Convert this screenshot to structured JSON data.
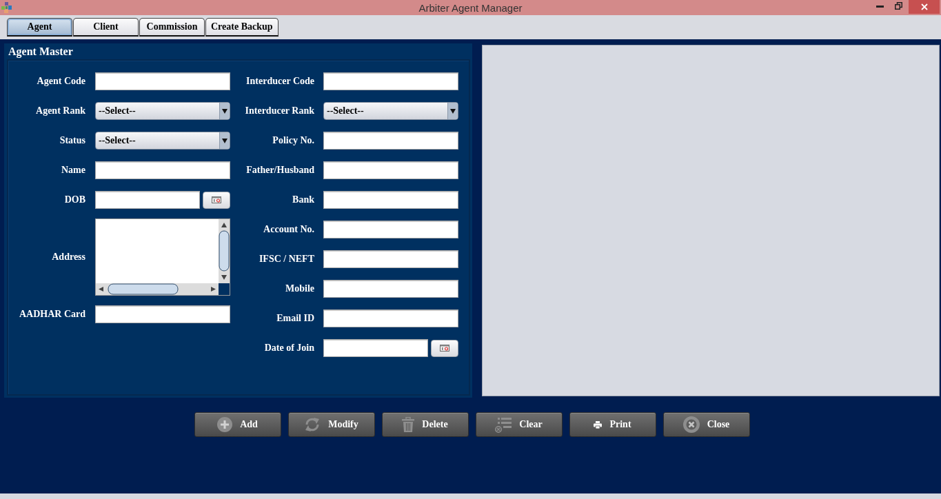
{
  "window": {
    "title": "Arbiter Agent Manager"
  },
  "tabs": [
    {
      "label": "Agent",
      "selected": true
    },
    {
      "label": "Client",
      "selected": false
    },
    {
      "label": "Commission",
      "selected": false
    },
    {
      "label": "Create Backup",
      "selected": false
    }
  ],
  "agent_master": {
    "title": "Agent Master",
    "left_fields": [
      {
        "label": "Agent Code",
        "kind": "text"
      },
      {
        "label": "Agent Rank",
        "kind": "select",
        "value": "--Select--"
      },
      {
        "label": "Status",
        "kind": "select",
        "value": "--Select--"
      },
      {
        "label": "Name",
        "kind": "text"
      },
      {
        "label": "DOB",
        "kind": "date"
      },
      {
        "label": "Address",
        "kind": "textarea"
      },
      {
        "label": "AADHAR Card",
        "kind": "text"
      }
    ],
    "right_fields": [
      {
        "label": "Interducer Code",
        "kind": "text"
      },
      {
        "label": "Interducer Rank",
        "kind": "select",
        "value": "--Select--"
      },
      {
        "label": "Policy No.",
        "kind": "text"
      },
      {
        "label": "Father/Husband",
        "kind": "text"
      },
      {
        "label": "Bank",
        "kind": "text"
      },
      {
        "label": "Account No.",
        "kind": "text"
      },
      {
        "label": "IFSC / NEFT",
        "kind": "text"
      },
      {
        "label": "Mobile",
        "kind": "text"
      },
      {
        "label": "Email ID",
        "kind": "text"
      },
      {
        "label": "Date of Join",
        "kind": "date"
      }
    ]
  },
  "buttons": [
    {
      "label": "Add",
      "kind": "add"
    },
    {
      "label": "Modify",
      "kind": "modify"
    },
    {
      "label": "Delete",
      "kind": "delete"
    },
    {
      "label": "Clear",
      "kind": "clear"
    },
    {
      "label": "Print",
      "kind": "print"
    },
    {
      "label": "Close",
      "kind": "close"
    }
  ]
}
